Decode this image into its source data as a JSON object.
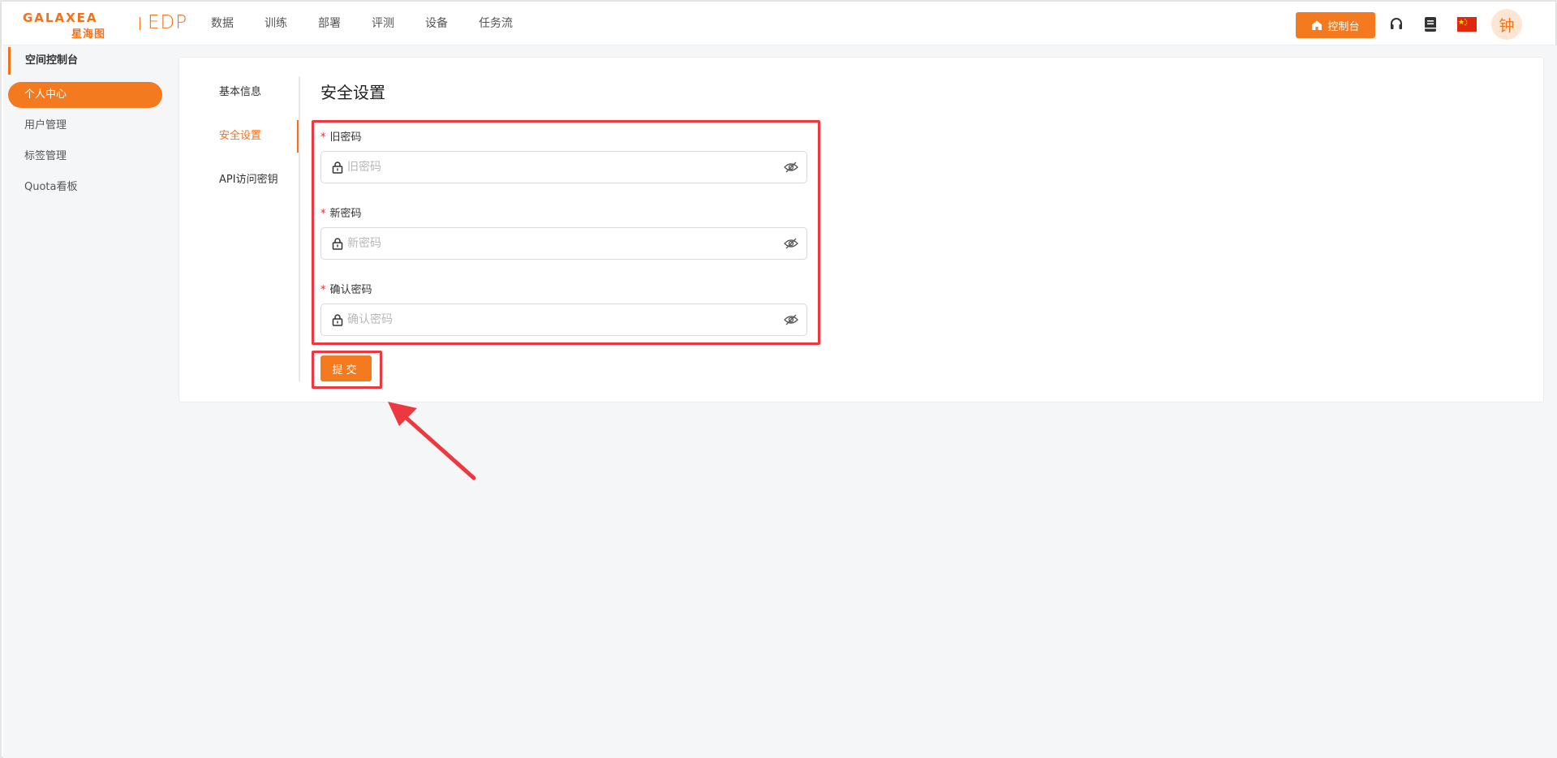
{
  "brand": {
    "logo_text": "GALAXEA",
    "logo_cn": "星海图",
    "product": "EDP"
  },
  "nav": [
    "数据",
    "训练",
    "部署",
    "评测",
    "设备",
    "任务流"
  ],
  "header": {
    "console_label": "控制台",
    "avatar_text": "钟"
  },
  "sidebar": {
    "title": "空间控制台",
    "items": [
      {
        "label": "个人中心",
        "active": true
      },
      {
        "label": "用户管理",
        "active": false
      },
      {
        "label": "标签管理",
        "active": false
      },
      {
        "label": "Quota看板",
        "active": false
      }
    ]
  },
  "tabs": [
    {
      "label": "基本信息",
      "active": false
    },
    {
      "label": "安全设置",
      "active": true
    },
    {
      "label": "API访问密钥",
      "active": false
    }
  ],
  "form": {
    "title": "安全设置",
    "required_mark": "*",
    "fields": [
      {
        "label": "旧密码",
        "placeholder": "旧密码"
      },
      {
        "label": "新密码",
        "placeholder": "新密码"
      },
      {
        "label": "确认密码",
        "placeholder": "确认密码"
      }
    ],
    "submit_label": "提交"
  },
  "colors": {
    "accent": "#f47a1f",
    "highlight": "#ee3840",
    "required": "#f5222d"
  }
}
